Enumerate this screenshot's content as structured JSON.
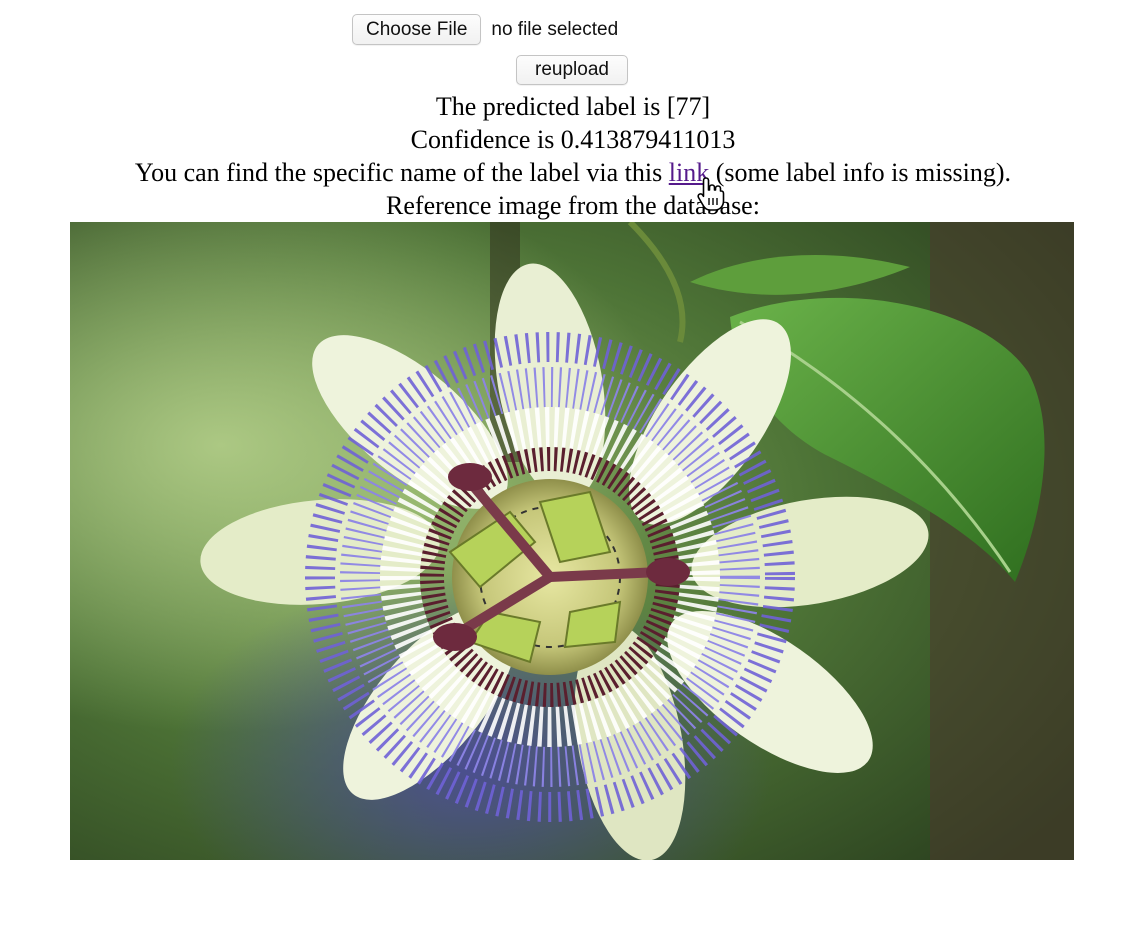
{
  "file_input": {
    "choose_label": "Choose File",
    "status": "no file selected"
  },
  "reupload_label": "reupload",
  "result": {
    "predicted_text": "The predicted label is [77]",
    "confidence_text": "Confidence is 0.413879411013",
    "info_prefix": "You can find the specific name of the label via this ",
    "link_text": "link",
    "info_suffix": " (some label info is missing).",
    "reference_text": "Reference image from the database:"
  },
  "reference_image": {
    "subject": "passion-flower",
    "colors": {
      "petal": "#eef3dc",
      "corona_violet": "#6f62d6",
      "corona_band": "#5a1f2e",
      "leaf": "#3f8a2a",
      "background": "#3c5c2a"
    }
  },
  "colors": {
    "link_visited": "#551a8b"
  }
}
